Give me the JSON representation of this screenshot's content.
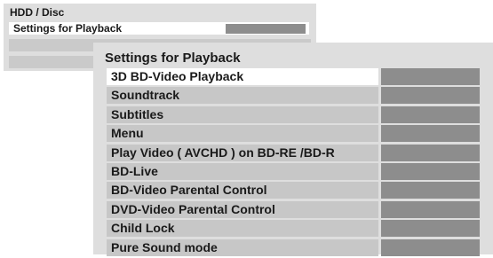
{
  "parent_menu": {
    "title": "HDD / Disc",
    "items": [
      {
        "label": "Settings for Playback",
        "selected": true
      },
      {
        "label": ""
      },
      {
        "label": ""
      }
    ]
  },
  "submenu": {
    "title": "Settings for Playback",
    "items": [
      {
        "label": "3D BD-Video Playback",
        "selected": true
      },
      {
        "label": "Soundtrack"
      },
      {
        "label": "Subtitles"
      },
      {
        "label": "Menu"
      },
      {
        "label": "Play Video ( AVCHD ) on BD-RE /BD-R"
      },
      {
        "label": "BD-Live"
      },
      {
        "label": "BD-Video Parental Control"
      },
      {
        "label": "DVD-Video Parental Control"
      },
      {
        "label": "Child Lock"
      },
      {
        "label": "Pure Sound mode"
      }
    ]
  },
  "colors": {
    "panel_background": "#dedede",
    "item_background": "#c7c7c7",
    "selected_item_background": "#ffffff",
    "value_box": "#8d8d8d",
    "text": "#1a1a1a"
  }
}
